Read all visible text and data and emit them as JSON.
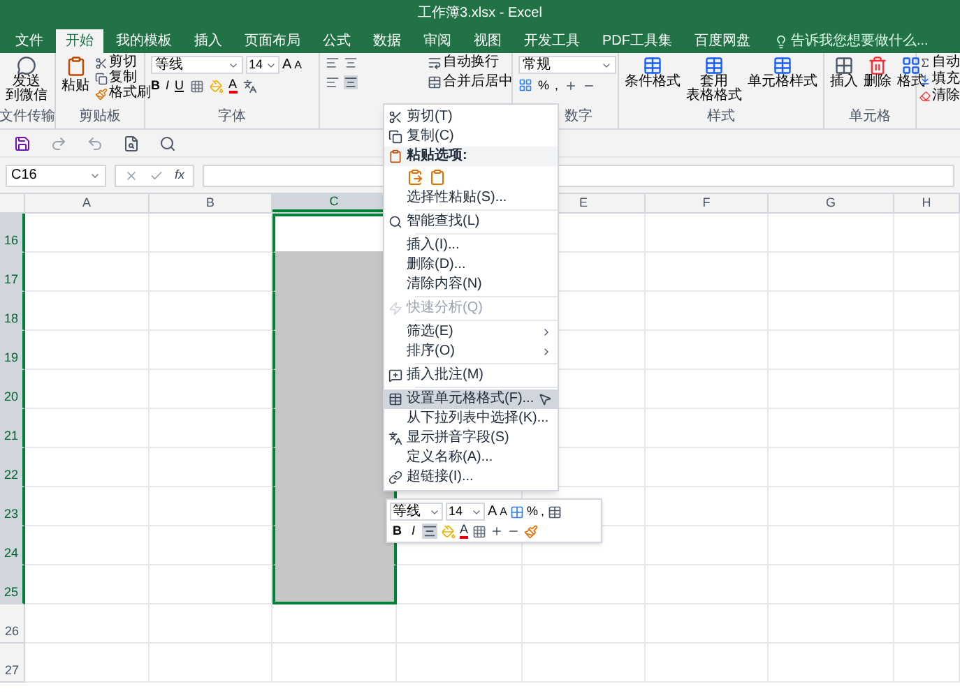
{
  "window": {
    "title": "工作簿3.xlsx - Excel"
  },
  "tabs": [
    {
      "label": "文件",
      "selected": false
    },
    {
      "label": "开始",
      "selected": true
    },
    {
      "label": "我的模板",
      "selected": false
    },
    {
      "label": "插入",
      "selected": false
    },
    {
      "label": "页面布局",
      "selected": false
    },
    {
      "label": "公式",
      "selected": false
    },
    {
      "label": "数据",
      "selected": false
    },
    {
      "label": "审阅",
      "selected": false
    },
    {
      "label": "视图",
      "selected": false
    },
    {
      "label": "开发工具",
      "selected": false
    },
    {
      "label": "PDF工具集",
      "selected": false
    },
    {
      "label": "百度网盘",
      "selected": false
    }
  ],
  "tell_me": {
    "placeholder": "告诉我您想要做什么..."
  },
  "ribbon": {
    "file_transfer": {
      "label": "文件传输",
      "button": [
        "发送",
        "到微信"
      ]
    },
    "clipboard": {
      "label": "剪贴板",
      "paste": "粘贴",
      "items": [
        "剪切",
        "复制",
        "格式刷"
      ]
    },
    "font": {
      "label": "字体",
      "font_name": "等线",
      "font_size": "14",
      "grow": "A",
      "shrink": "A",
      "bold": "B",
      "italic": "I",
      "underline": "U",
      "font_color_label": "A"
    },
    "alignment": {
      "wrap": "自动换行",
      "merge": "合并后居中"
    },
    "number": {
      "label": "数字",
      "format": "常规",
      "percent": "%",
      "comma": ","
    },
    "styles": {
      "label": "样式",
      "buttons": [
        [
          "条件格式"
        ],
        [
          "套用",
          "表格格式"
        ],
        [
          "单元格样式"
        ]
      ]
    },
    "cells": {
      "label": "单元格",
      "buttons": [
        "插入",
        "删除",
        "格式"
      ]
    },
    "editing": {
      "items": [
        "自动",
        "填充",
        "清除"
      ]
    }
  },
  "formula_bar": {
    "name_box": "C16",
    "fx": "fx"
  },
  "sheet": {
    "columns": [
      {
        "label": "A",
        "selected": false
      },
      {
        "label": "B",
        "selected": false
      },
      {
        "label": "C",
        "selected": true
      },
      {},
      {
        "label": "E",
        "selected": false
      },
      {
        "label": "F",
        "selected": false
      },
      {
        "label": "G",
        "selected": false
      },
      {
        "label": "H",
        "selected": false
      }
    ],
    "rows": [
      {
        "label": "16",
        "selected": true
      },
      {
        "label": "17",
        "selected": true
      },
      {
        "label": "18",
        "selected": true
      },
      {
        "label": "19",
        "selected": true
      },
      {
        "label": "20",
        "selected": true
      },
      {
        "label": "21",
        "selected": true
      },
      {
        "label": "22",
        "selected": true
      },
      {
        "label": "23",
        "selected": true
      },
      {
        "label": "24",
        "selected": true
      },
      {
        "label": "25",
        "selected": true
      },
      {
        "label": "26",
        "selected": false
      },
      {
        "label": "27",
        "selected": false
      }
    ]
  },
  "context_menu": [
    {
      "kind": "item",
      "label": "剪切(T)",
      "disabled": false,
      "submenu": false,
      "selected": false
    },
    {
      "kind": "item",
      "label": "复制(C)",
      "disabled": false,
      "submenu": false,
      "selected": false
    },
    {
      "kind": "header",
      "label": "粘贴选项:"
    },
    {
      "kind": "paste_icons"
    },
    {
      "kind": "item",
      "label": "选择性粘贴(S)...",
      "disabled": false,
      "submenu": false,
      "selected": false
    },
    {
      "kind": "separator"
    },
    {
      "kind": "item",
      "label": "智能查找(L)",
      "disabled": false,
      "submenu": false,
      "selected": false
    },
    {
      "kind": "separator"
    },
    {
      "kind": "item",
      "label": "插入(I)...",
      "disabled": false,
      "submenu": false,
      "selected": false
    },
    {
      "kind": "item",
      "label": "删除(D)...",
      "disabled": false,
      "submenu": false,
      "selected": false
    },
    {
      "kind": "item",
      "label": "清除内容(N)",
      "disabled": false,
      "submenu": false,
      "selected": false
    },
    {
      "kind": "separator"
    },
    {
      "kind": "item",
      "label": "快速分析(Q)",
      "disabled": true,
      "submenu": false,
      "selected": false
    },
    {
      "kind": "separator"
    },
    {
      "kind": "item",
      "label": "筛选(E)",
      "disabled": false,
      "submenu": true,
      "selected": false
    },
    {
      "kind": "item",
      "label": "排序(O)",
      "disabled": false,
      "submenu": true,
      "selected": false
    },
    {
      "kind": "separator"
    },
    {
      "kind": "item",
      "label": "插入批注(M)",
      "disabled": false,
      "submenu": false,
      "selected": false
    },
    {
      "kind": "separator"
    },
    {
      "kind": "item",
      "label": "设置单元格格式(F)...",
      "disabled": false,
      "submenu": false,
      "selected": true
    },
    {
      "kind": "item",
      "label": "从下拉列表中选择(K)...",
      "disabled": false,
      "submenu": false,
      "selected": false
    },
    {
      "kind": "item",
      "label": "显示拼音字段(S)",
      "disabled": false,
      "submenu": false,
      "selected": false
    },
    {
      "kind": "item",
      "label": "定义名称(A)...",
      "disabled": false,
      "submenu": false,
      "selected": false
    },
    {
      "kind": "item",
      "label": "超链接(I)...",
      "disabled": false,
      "submenu": false,
      "selected": false
    }
  ],
  "mini_toolbar": {
    "font_name": "等线",
    "font_size": "14",
    "grow": "A",
    "shrink": "A",
    "percent": "%",
    "comma": ",",
    "bold": "B",
    "italic": "I",
    "font_color_label": "A"
  }
}
